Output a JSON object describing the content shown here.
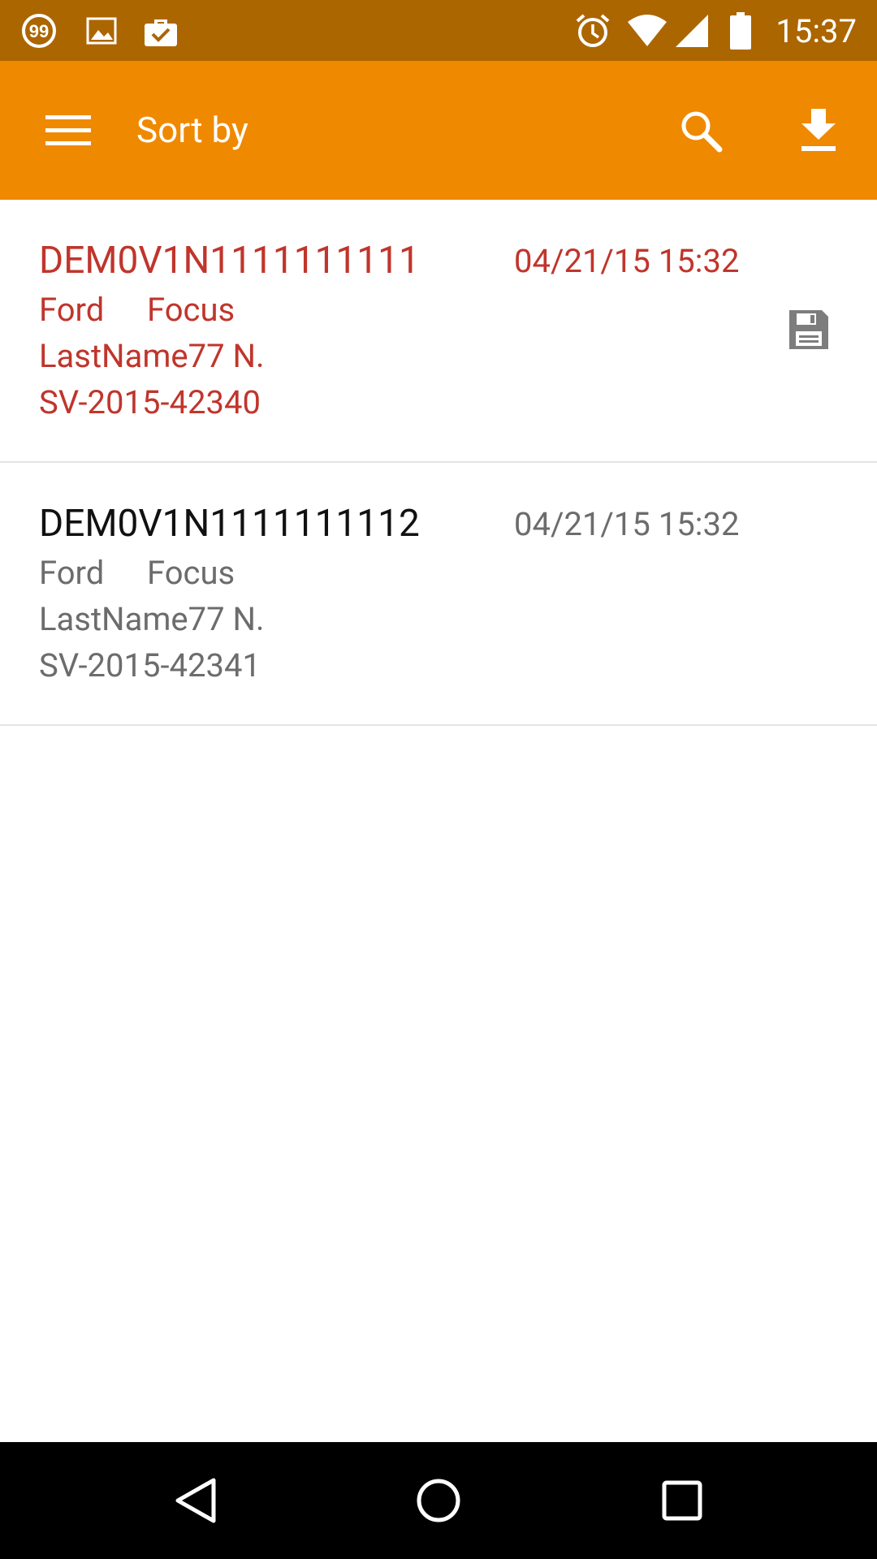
{
  "status_bar": {
    "time": "15:37",
    "left_icons": [
      "quote-notification-icon",
      "image-notification-icon",
      "briefcase-check-icon"
    ],
    "right_icons": [
      "alarm-icon",
      "wifi-icon",
      "cell-signal-icon",
      "battery-icon"
    ],
    "badge_text": "99"
  },
  "app_bar": {
    "title": "Sort by",
    "actions": [
      "search-icon",
      "download-icon"
    ]
  },
  "items": [
    {
      "vin": "DEM0V1N1111111111",
      "date": "04/21/15 15:32",
      "make": "Ford",
      "model": "Focus",
      "owner": "LastName77 N.",
      "ref": "SV-2015-42340",
      "saved": true
    },
    {
      "vin": "DEM0V1N1111111112",
      "date": "04/21/15 15:32",
      "make": "Ford",
      "model": "Focus",
      "owner": "LastName77 N.",
      "ref": "SV-2015-42341",
      "saved": false
    }
  ],
  "nav_bar": {
    "buttons": [
      "back-icon",
      "home-icon",
      "recents-icon"
    ]
  },
  "colors": {
    "status_bar": "#ac6600",
    "app_bar": "#ef8900",
    "highlight_text": "#c0352c",
    "secondary_text": "#6c6c6c"
  }
}
